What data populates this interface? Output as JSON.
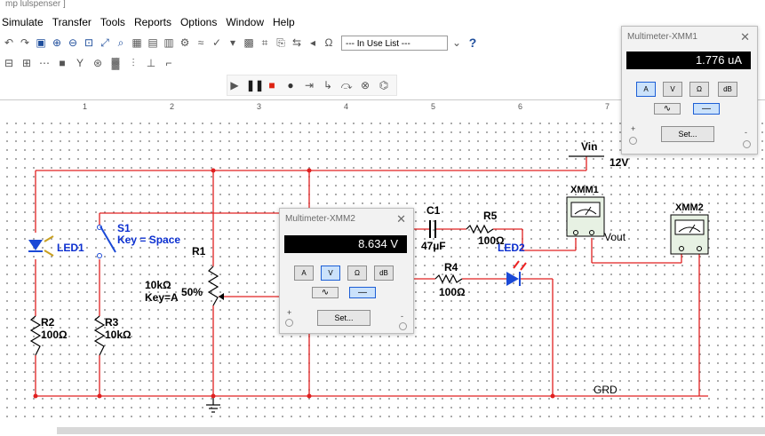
{
  "window": {
    "title": "mp lulspenser ]"
  },
  "menu": [
    "Simulate",
    "Transfer",
    "Tools",
    "Reports",
    "Options",
    "Window",
    "Help"
  ],
  "toolbar": {
    "in_use_list": "--- In Use List ---",
    "help_glyph": "?"
  },
  "ruler": [
    "1",
    "2",
    "3",
    "4",
    "5",
    "6",
    "7"
  ],
  "schematic": {
    "vin_label": "Vin",
    "vin_value": "12V",
    "led1": "LED1",
    "s1": "S1",
    "s1_key": "Key = Space",
    "r1": "R1",
    "r1_value": "10kΩ",
    "r1_key": "Key=A",
    "r1_percent": "50%",
    "r2": "R2",
    "r2_value": "100Ω",
    "r3": "R3",
    "r3_value": "10kΩ",
    "c1": "C1",
    "c1_value": "47µF",
    "r5": "R5",
    "r5_value": "100Ω",
    "led2": "LED2",
    "r4": "R4",
    "r4_value": "100Ω",
    "xmm1": "XMM1",
    "xmm2": "XMM2",
    "vout": "Vout",
    "grd": "GRD",
    "colors": {
      "wire": "#e02020",
      "component_label": "#0b2fd0"
    }
  },
  "multimeters": [
    {
      "title": "Multimeter-XMM1",
      "reading": "1.776 uA",
      "modes": [
        "A",
        "V",
        "Ω",
        "dB"
      ],
      "selected_mode": "A",
      "set": "Set...",
      "plus": "+",
      "minus": "-"
    },
    {
      "title": "Multimeter-XMM2",
      "reading": "8.634 V",
      "modes": [
        "A",
        "V",
        "Ω",
        "dB"
      ],
      "selected_mode": "V",
      "set": "Set...",
      "plus": "+",
      "minus": "-"
    }
  ]
}
